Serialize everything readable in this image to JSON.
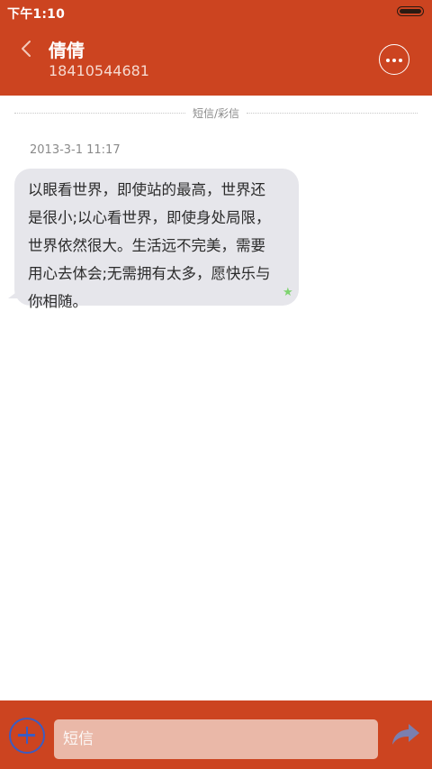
{
  "status_bar": {
    "time": "下午1:10"
  },
  "header": {
    "contact_name": "倩倩",
    "contact_number": "18410544681",
    "back_icon": "chevron-left-icon",
    "more_icon": "more-dots-icon"
  },
  "conversation": {
    "divider_label": "短信/彩信",
    "messages": [
      {
        "timestamp": "2013-3-1 11:17",
        "text": "以眼看世界，即使站的最高，世界还是很小;以心看世界，即使身处局限，世界依然很大。生活远不完美，需要用心去体会;无需拥有太多，愿快乐与你相随。",
        "status_icon": "star-icon"
      }
    ]
  },
  "composer": {
    "placeholder": "短信",
    "add_icon": "plus-circle-icon",
    "send_icon": "send-arrow-icon"
  },
  "colors": {
    "header_bg": "#cc4420",
    "bubble_bg": "#e6e6eb",
    "accent_blue": "#3b5cc2",
    "star_green": "#7ed36f"
  }
}
